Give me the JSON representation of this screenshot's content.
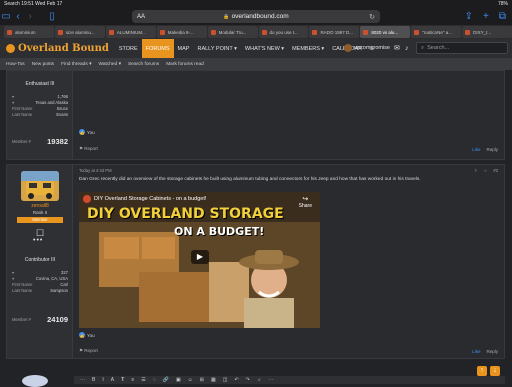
{
  "status_bar": {
    "time": "Search  19:51  Wed Feb 17",
    "battery": "78%"
  },
  "safari": {
    "text_size_label": "AA",
    "url": "overlandbound.com"
  },
  "tabs": [
    {
      "label": "aluminium"
    },
    {
      "label": "size aluminu..."
    },
    {
      "label": "ALUMINIUM..."
    },
    {
      "label": "Makedia 8-..."
    },
    {
      "label": "Modular Tru..."
    },
    {
      "label": "do you use t..."
    },
    {
      "label": "RADO 1997 D..."
    },
    {
      "label": "8020 vs alu...",
      "active": true
    },
    {
      "label": "\"rusticoNe\" a..."
    },
    {
      "label": "DIXY_t..."
    }
  ],
  "site_nav": {
    "logo": "Overland Bound",
    "items": [
      "STORE",
      "FORUMS",
      "MAP",
      "RALLY POINT ▾",
      "WHAT'S NEW ▾",
      "MEMBERS ▾",
      "CALENDAR",
      "S"
    ],
    "active_item": "FORUMS",
    "username": "uncompromise",
    "search_placeholder": "Search..."
  },
  "sub_nav": [
    "How-Tos",
    "New posts",
    "Find threads ▾",
    "Watched ▾",
    "Search forums",
    "Mark forums read"
  ],
  "post1": {
    "rank": "Enthusiast III",
    "stats": [
      {
        "label": "",
        "value": "1,766"
      },
      {
        "label": "",
        "value": "Texas and Alaska"
      },
      {
        "label": "First Name",
        "value": "Bruce"
      },
      {
        "label": "Last Name",
        "value": "Evans"
      }
    ],
    "member_label": "Member #",
    "member_no": "19382",
    "like_text": "You",
    "report": "Report",
    "like": "Like",
    "reply": "Reply"
  },
  "post2": {
    "username": "zeroall8",
    "rank_line": "Rank II",
    "badge": "Member",
    "contributor": "Contributor III",
    "stats": [
      {
        "label": "",
        "value": "327"
      },
      {
        "label": "",
        "value": "Covina, CA, USA"
      },
      {
        "label": "First Name",
        "value": "Carl"
      },
      {
        "label": "Last Name",
        "value": "Sampson"
      }
    ],
    "member_label": "Member #",
    "member_no": "24109",
    "timestamp": "Today at 4:43 PM",
    "post_number": "#3",
    "body": "Dan Grec recently did an overview of the storage cabinets he built using aluminum tubing and connectors for his Jeep and how that has worked out in his travels.",
    "video_title": "DIY Overland Storage Cabinets - on a budget!",
    "video_big_title_1": "DIY OVERLAND STORAGE",
    "video_big_title_2": "ON A BUDGET!",
    "share_label": "Share",
    "like_text": "You",
    "report": "Report",
    "like": "Like",
    "reply": "Reply"
  },
  "editor": {
    "tools": [
      "⋯",
      "B",
      "I",
      "A",
      "𝐓",
      "≡",
      "☰",
      "◌",
      "🔗",
      "▣",
      "☺",
      "⊞",
      "▦",
      "◫",
      "↶",
      "↷",
      "☼",
      "⋯"
    ]
  },
  "colors": {
    "accent": "#e8941e",
    "link_blue": "#3d8ef5",
    "background": "#222326"
  }
}
